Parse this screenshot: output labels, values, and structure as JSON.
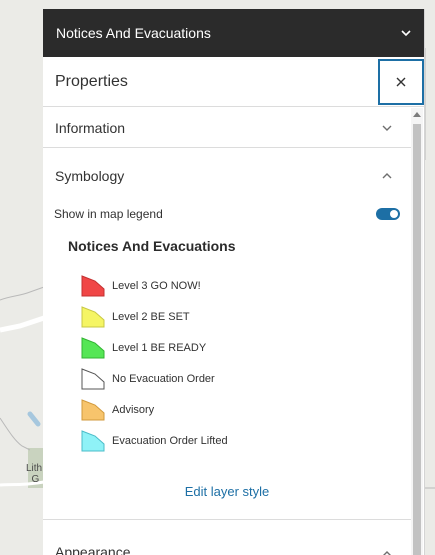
{
  "layer": {
    "title": "Notices And Evacuations"
  },
  "properties": {
    "title": "Properties",
    "close_icon": "close-icon"
  },
  "sections": {
    "information": {
      "label": "Information",
      "expanded": false
    },
    "symbology": {
      "label": "Symbology",
      "expanded": true
    },
    "appearance": {
      "label": "Appearance",
      "expanded": true
    }
  },
  "symbology": {
    "show_in_legend_label": "Show in map legend",
    "show_in_legend": true,
    "legend_title": "Notices And Evacuations",
    "items": [
      {
        "label": "Level 3 GO NOW!",
        "fill": "#f04646",
        "stroke": "#c33030"
      },
      {
        "label": "Level 2 BE SET",
        "fill": "#f5f564",
        "stroke": "#c8c844"
      },
      {
        "label": "Level 1 BE READY",
        "fill": "#55e655",
        "stroke": "#32b432"
      },
      {
        "label": "No Evacuation Order",
        "fill": "#ffffff",
        "stroke": "#555555"
      },
      {
        "label": "Advisory",
        "fill": "#f7c46c",
        "stroke": "#d29a3c"
      },
      {
        "label": "Evacuation Order Lifted",
        "fill": "#8ff2f7",
        "stroke": "#4bbcc8"
      }
    ],
    "edit_link": "Edit layer style"
  },
  "map": {
    "partial_label": "Lith\nG"
  },
  "colors": {
    "accent": "#1d6fa5",
    "header_bg": "#2b2b2b"
  }
}
